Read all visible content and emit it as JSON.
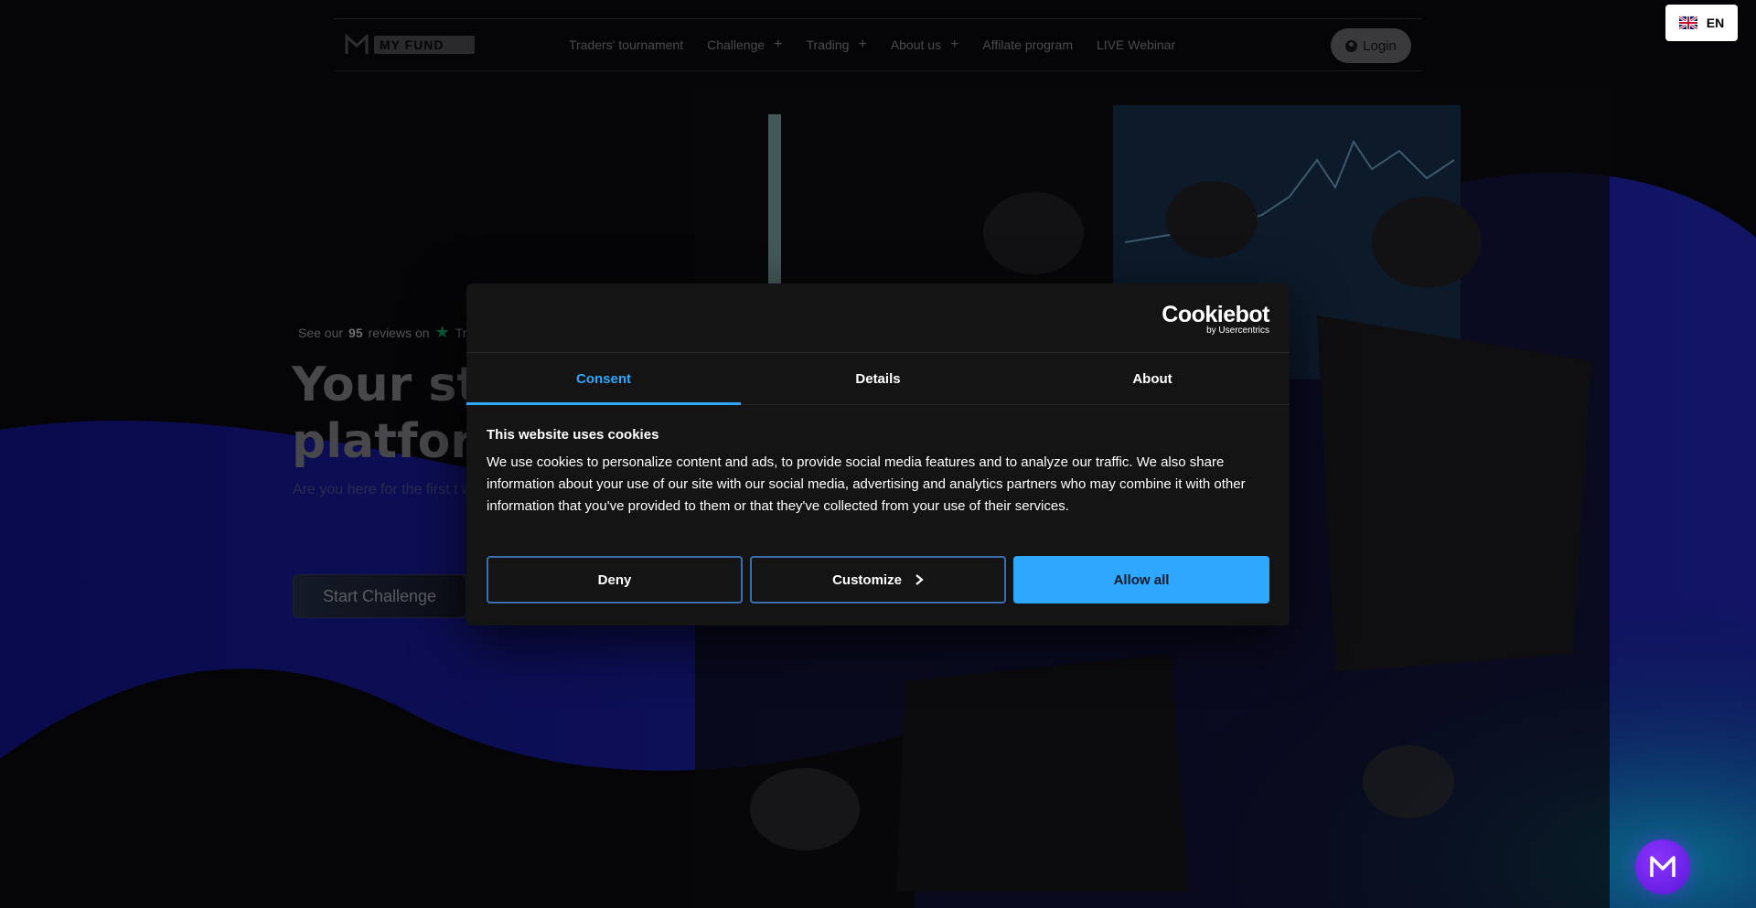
{
  "nav": {
    "logo_text": "MY FUND",
    "links": [
      {
        "label": "Traders' tournament",
        "has_plus": false
      },
      {
        "label": "Challenge",
        "has_plus": true
      },
      {
        "label": "Trading",
        "has_plus": true
      },
      {
        "label": "About us",
        "has_plus": true
      },
      {
        "label": "Affilate program",
        "has_plus": false
      },
      {
        "label": "LIVE Webinar",
        "has_plus": false
      }
    ],
    "login_label": "Login",
    "lang_label": "EN"
  },
  "hero": {
    "reviews_prefix": "See our",
    "reviews_count": "95",
    "reviews_suffix": "reviews on",
    "reviews_site": "Tru",
    "title_line1": "Your stra",
    "title_line2": "platform",
    "subtitle": "Are you here for the first t well what you are looking answers",
    "start_label": "Start Challenge"
  },
  "cookie_dialog": {
    "brand": "Cookiebot",
    "brand_sub": "by Usercentrics",
    "tabs": [
      "Consent",
      "Details",
      "About"
    ],
    "active_tab": "Consent",
    "heading": "This website uses cookies",
    "body": "We use cookies to personalize content and ads, to provide social media features and to analyze our traffic. We also share information about your use of our site with our social media, advertising and analytics partners who may combine it with other information that you've provided to them or that they've collected from your use of their services.",
    "deny_label": "Deny",
    "customize_label": "Customize",
    "allow_label": "Allow all"
  },
  "colors": {
    "accent": "#2ea8ff",
    "fab": "#7a2cff"
  },
  "icons": {
    "user": "user-circle-icon",
    "plus": "plus-icon",
    "chevron": "chevron-right-icon",
    "star": "trustpilot-star-icon",
    "flag": "uk-flag-icon"
  }
}
